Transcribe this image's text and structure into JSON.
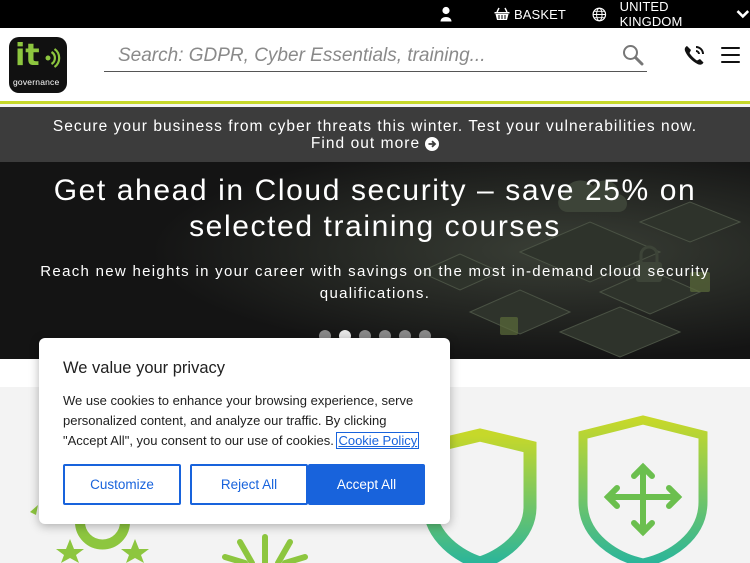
{
  "topbar": {
    "user_icon": "user-icon",
    "basket_icon": "basket-icon",
    "basket_label": "BASKET",
    "globe_icon": "globe-icon",
    "region_label": "UNITED KINGDOM",
    "region_chevron": "chevron-down-icon"
  },
  "header": {
    "logo_text_main": "it",
    "logo_text_sub": "governance",
    "search_placeholder": "Search: GDPR, Cyber Essentials, training...",
    "search_icon": "search-icon",
    "phone_icon": "phone-icon",
    "menu_icon": "hamburger-menu-icon"
  },
  "promo": {
    "line1": "Secure your business from cyber threats this winter. Test your vulnerabilities now.",
    "link_label": "Find out more",
    "link_icon": "arrow-right-circle-icon"
  },
  "hero": {
    "title_line1": "Get ahead in Cloud security – save 25% on",
    "title_line2": "selected training courses",
    "subtitle_line1": "Reach new heights in your career with savings on the most in-demand cloud security",
    "subtitle_line2": "qualifications.",
    "slides_total": 6,
    "active_slide": 2
  },
  "cookie": {
    "title": "We value your privacy",
    "body_line1": "We use cookies to enhance your browsing experience, serve",
    "body_line2": "personalized content, and analyze our traffic. By clicking",
    "body_line3": "\"Accept All\", you consent to our use of cookies.",
    "policy_link": "Cookie Policy",
    "customize_label": "Customize",
    "reject_label": "Reject All",
    "accept_label": "Accept All"
  },
  "colors": {
    "brand_green": "#8dc63f",
    "accent_lime": "#c6d82a",
    "button_blue": "#1863dc",
    "promo_bg": "#3c3c3c",
    "topbar_bg": "#000000"
  }
}
